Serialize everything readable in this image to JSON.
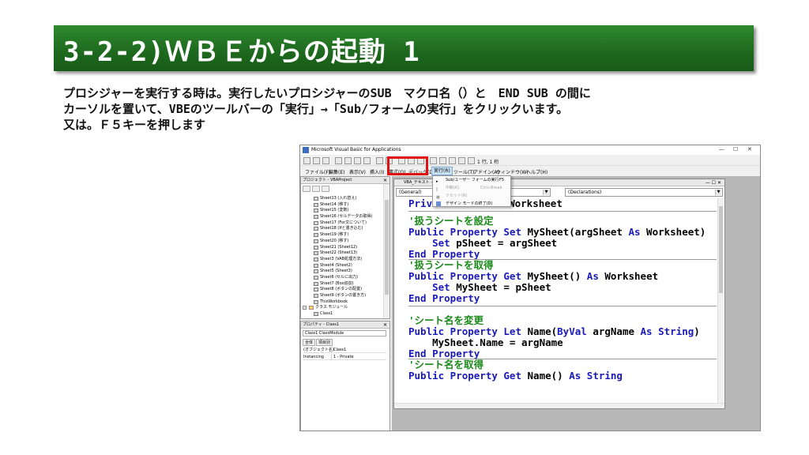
{
  "slide": {
    "title": "3-2-2)ＷＢＥからの起動 1",
    "description": [
      "プロシジャーを実行する時は。実行したいプロシジャーのSUB　マクロ名（）と　END SUB の間に",
      "カーソルを置いて、VBEのツールバーの「実行」→「Sub/フォームの実行」をクリックいます。",
      "又は。Ｆ５キーを押します"
    ]
  },
  "window": {
    "title": "Microsoft Visual Basic for Applications",
    "position_label": "1 行, 1 桁",
    "menu": [
      "ファイル(F)",
      "編集(E)",
      "表示(V)",
      "挿入(I)",
      "書式(O)",
      "デバッグ(D)",
      "実行(R)",
      "ツール(T)",
      "アドイン(A)",
      "ウィンドウ(W)",
      "ヘルプ(H)"
    ],
    "dropdown": [
      {
        "label": "Sub/ユーザー フォームの実行",
        "shortcut": "F5",
        "disabled": false
      },
      {
        "label": "中断(K)",
        "shortcut": "Ctrl+Break",
        "disabled": true
      },
      {
        "label": "リセット(R)",
        "shortcut": "",
        "disabled": true
      },
      {
        "label": "デザイン モードの終了(D)",
        "shortcut": "",
        "disabled": false
      }
    ]
  },
  "project": {
    "title": "プロジェクト - VBAProject",
    "items": [
      "Sheet13 (入れ替え)",
      "Sheet14 (移す)",
      "Sheet15 (変数)",
      "Sheet16 (セルデータの取得)",
      "Sheet17 (For文について)",
      "Sheet18 (Ifと書き込む)",
      "Sheet19 (移す)",
      "Sheet20 (移す)",
      "Sheet21 (Sheet12)",
      "Sheet22 (Sheet13)",
      "Sheet3 (VAB処理方法)",
      "Sheet4 (Sheet2)",
      "Sheet5 (Sheet3)",
      "Sheet6 (セルに出力)",
      "Sheet7 (Boo追加)",
      "Sheet8 (ボタンの配置)",
      "Sheet9 (ボタンの置き方)",
      "ThisWorkbook"
    ],
    "folder": "クラス モジュール",
    "class_item": "Class1"
  },
  "properties": {
    "title": "プロパティ - Class1",
    "selector": "Class1 ClassModule",
    "tabs": [
      "全体",
      "項目別"
    ],
    "rows": [
      {
        "key": "(オブジェクト名)",
        "value": "Class1"
      },
      {
        "key": "Instancing",
        "value": "1 - Private"
      }
    ]
  },
  "code": {
    "window_title": "VBA_テキスト - Class1 (コード)",
    "object_combo": "(General)",
    "proc_combo": "(Declarations)",
    "first_prefix": "Priv",
    "first_suffix": "Worksheet"
  }
}
